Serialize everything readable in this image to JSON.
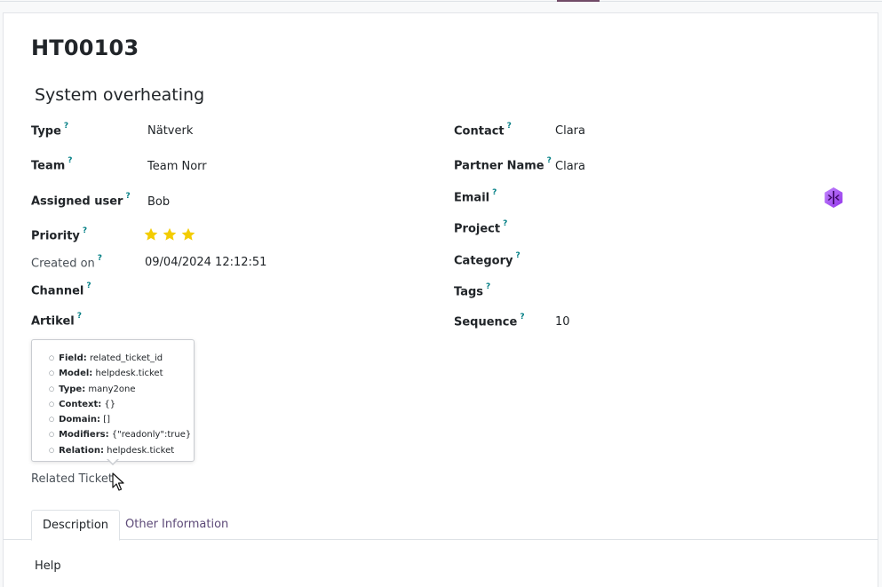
{
  "ticket": {
    "reference": "HT00103",
    "subject": "System overheating"
  },
  "help_marker": "?",
  "left_fields": {
    "type": {
      "label": "Type",
      "value": "Nätverk"
    },
    "team": {
      "label": "Team",
      "value": "Team Norr"
    },
    "assigned_user": {
      "label": "Assigned user",
      "value": "Bob"
    },
    "priority": {
      "label": "Priority",
      "stars_filled": 3,
      "stars_total": 3,
      "star_color": "#f3cc00"
    },
    "created_on": {
      "label": "Created on",
      "value": "09/04/2024 12:12:51"
    },
    "channel": {
      "label": "Channel",
      "value": ""
    },
    "artikel": {
      "label": "Artikel",
      "value": ""
    },
    "related_ticket": {
      "label": "Related Ticket",
      "value": ""
    }
  },
  "right_fields": {
    "contact": {
      "label": "Contact",
      "value": "Clara"
    },
    "partner_name": {
      "label": "Partner Name",
      "value": "Clara"
    },
    "email": {
      "label": "Email",
      "value": ""
    },
    "project": {
      "label": "Project",
      "value": ""
    },
    "category": {
      "label": "Category",
      "value": ""
    },
    "tags": {
      "label": "Tags",
      "value": ""
    },
    "sequence": {
      "label": "Sequence",
      "value": "10"
    }
  },
  "tooltip": {
    "rows": [
      {
        "key": "Field:",
        "value": "related_ticket_id"
      },
      {
        "key": "Model:",
        "value": "helpdesk.ticket"
      },
      {
        "key": "Type:",
        "value": "many2one"
      },
      {
        "key": "Context:",
        "value": "{}"
      },
      {
        "key": "Domain:",
        "value": "[]"
      },
      {
        "key": "Modifiers:",
        "value": "{\"readonly\":true}"
      },
      {
        "key": "Relation:",
        "value": "helpdesk.ticket"
      }
    ]
  },
  "tabs": [
    {
      "label": "Description",
      "active": true
    },
    {
      "label": "Other Information",
      "active": false
    }
  ],
  "description": {
    "text": "Help"
  },
  "colors": {
    "accent": "#714b67",
    "help_marker": "#017e84",
    "link_tab": "#5d4a78",
    "avatar_icon": "#a855f7"
  },
  "icons": {
    "avatar": "ai-sparkle-icon",
    "star": "star-icon",
    "cursor": "mouse-pointer-icon"
  }
}
